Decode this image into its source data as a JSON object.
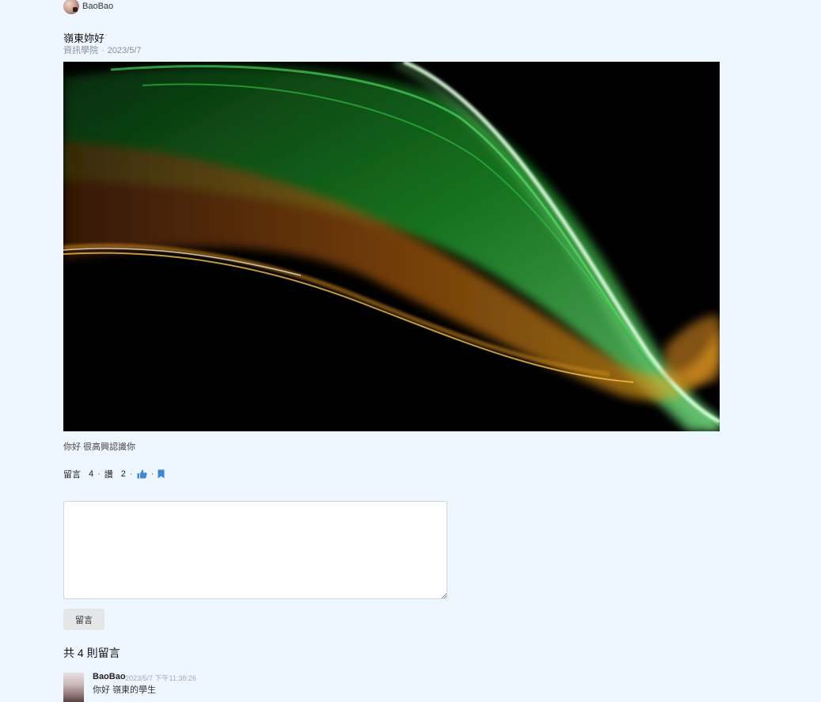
{
  "author": {
    "name": "BaoBao"
  },
  "post": {
    "title": "嶺東妳好",
    "category": "資訊學院",
    "date": "2023/5/7",
    "body": "你好 很高興認識你"
  },
  "stats": {
    "comments_label": "留言",
    "comments_count": "4",
    "likes_label": "讚",
    "likes_count": "2",
    "like_icon": "thumbs-up-icon",
    "bookmark_icon": "bookmark-icon",
    "accent_color": "#3d86d8"
  },
  "comment_form": {
    "value": "",
    "submit_label": "留言"
  },
  "comments": {
    "heading": "共 4 則留言",
    "items": [
      {
        "author": "BaoBao",
        "time": "2023/5/7 下午11:38:26",
        "text": "你好 嶺東的學生"
      }
    ]
  }
}
